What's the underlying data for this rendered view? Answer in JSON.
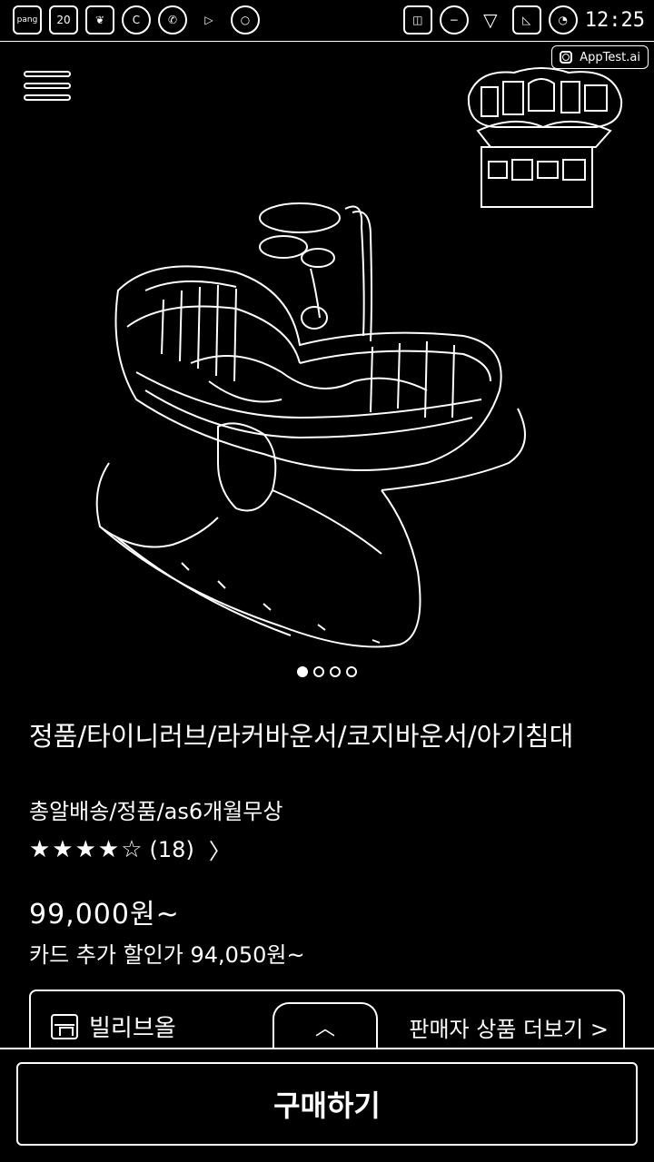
{
  "status_bar": {
    "left_icons": [
      "pang-icon",
      "calendar-icon",
      "leaf-icon",
      "c-app-icon",
      "phone-icon",
      "play-icon",
      "circle-icon"
    ],
    "left_icon_text": {
      "pang": "pang",
      "calendar": "20"
    },
    "right_icons": [
      "cast-icon",
      "minus-icon",
      "wifi-icon",
      "no-signal-icon",
      "alarm-icon"
    ],
    "time": "12:25"
  },
  "app_badge": {
    "label": "AppTest.ai"
  },
  "product": {
    "title": "정품/타이니러브/라커바운서/코지바운서/아기침대",
    "subtitle": "총알배송/정품/as6개월무상",
    "rating_stars": "★★★★☆",
    "review_count": "(18)",
    "price": "99,000원~",
    "card_discount": "카드 추가 할인가 94,050원~",
    "image_pages": 4,
    "active_page": 0
  },
  "seller": {
    "store_name": "빌리브올",
    "more_products": "판매자 상품 더보기 >"
  },
  "buy_button": {
    "label": "구매하기"
  },
  "colors": {
    "background": "#000000",
    "foreground": "#ffffff"
  }
}
